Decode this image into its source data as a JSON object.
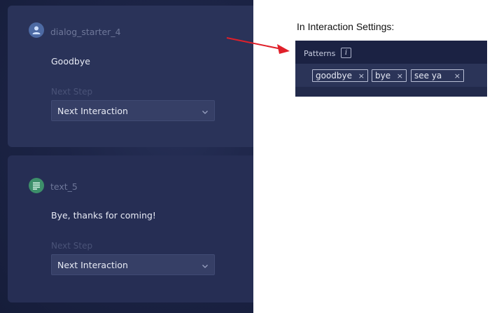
{
  "nodes": [
    {
      "title": "dialog_starter_4",
      "icon": "user-icon",
      "message": "Goodbye",
      "next_step_label": "Next Step",
      "next_step_value": "Next Interaction"
    },
    {
      "title": "text_5",
      "icon": "text-lines-icon",
      "message": "Bye, thanks for coming!",
      "next_step_label": "Next Step",
      "next_step_value": "Next Interaction"
    }
  ],
  "annotation": {
    "caption": "In Interaction Settings:",
    "arrow_color": "#e0202a"
  },
  "settings_panel": {
    "patterns_label": "Patterns",
    "info_glyph": "i",
    "tags": [
      {
        "text": "goodbye",
        "remove": "×"
      },
      {
        "text": "bye",
        "remove": "×"
      },
      {
        "text": "see ya",
        "remove": "×"
      }
    ]
  },
  "colors": {
    "canvas_bg": "#1c2446",
    "card_bg": "#2a3359",
    "user_icon_bg": "#4d6aa3",
    "text_icon_bg": "#3d8f6a"
  }
}
